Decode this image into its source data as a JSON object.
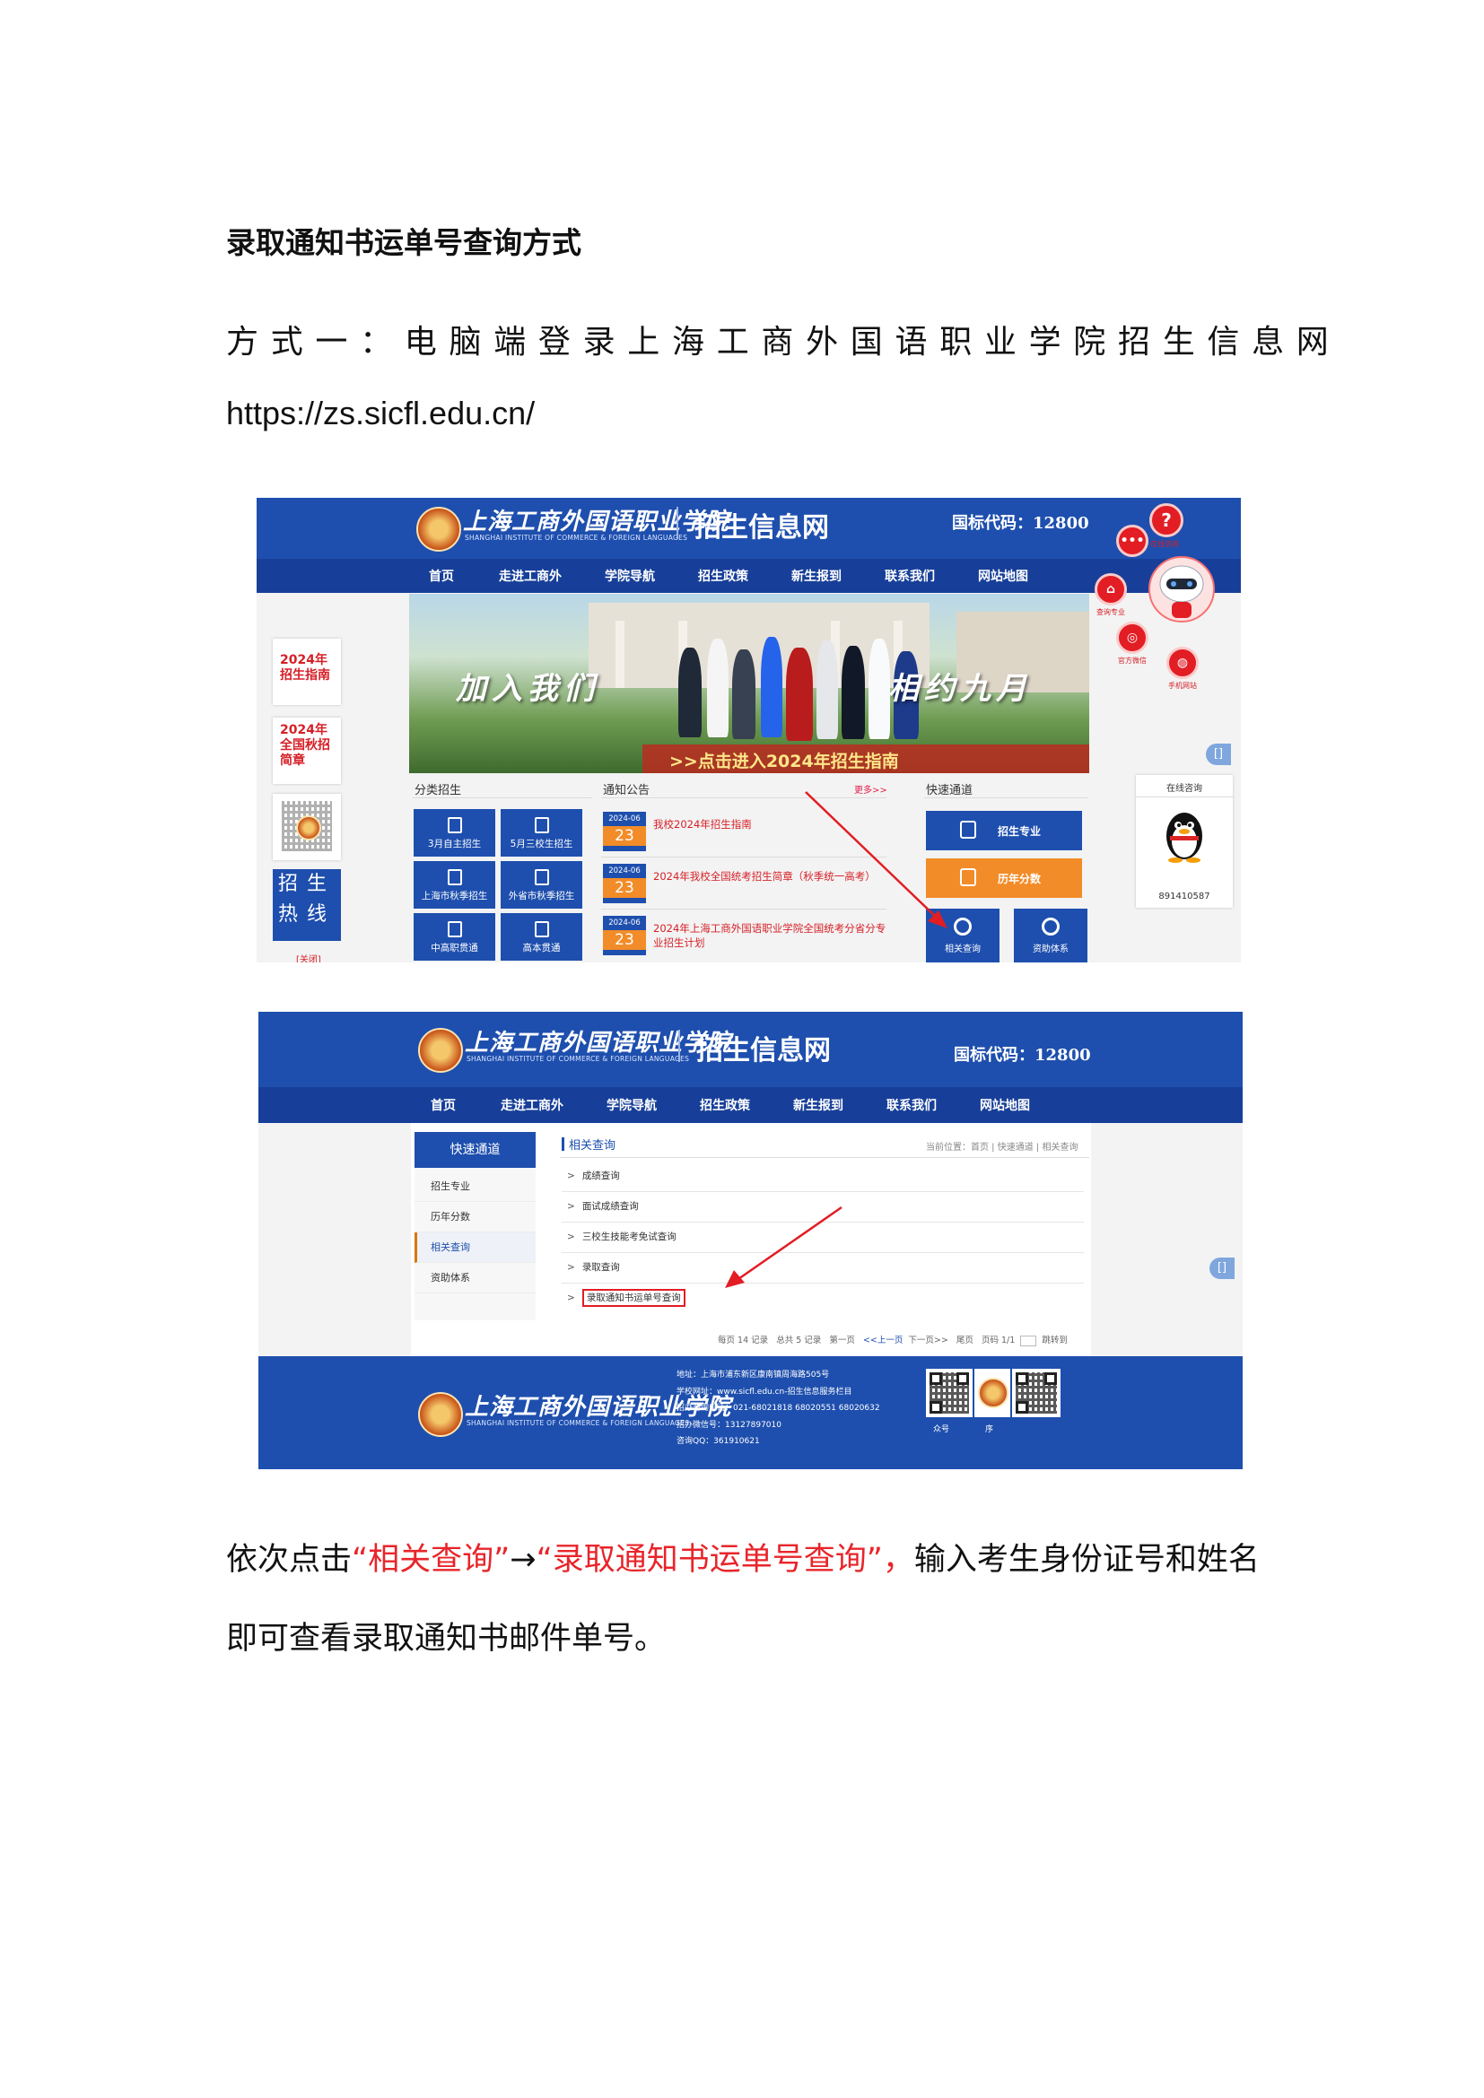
{
  "document": {
    "heading": "录取通知书运单号查询方式",
    "method_one": "方式一：电脑端登录上海工商外国语职业学院招生信息网",
    "url": "https://zs.sicfl.edu.cn/",
    "instruction": {
      "line1_prefix": "依次点击",
      "highlight1": "“相关查询”",
      "arrow": "→",
      "highlight2": "“录取通知书运单号查询”，",
      "line1_suffix": "输入考生身份证号和姓名",
      "line2": "即可查看录取通知书邮件单号。"
    }
  },
  "site": {
    "logo_text": "上海工商外国语职业学院",
    "logo_sub": "SHANGHAI INSTITUTE OF COMMERCE & FOREIGN LANGUAGES",
    "name": "招生信息网",
    "intl_code": "国标代码：12800",
    "nav": [
      "首页",
      "走进工商外",
      "学院导航",
      "招生政策",
      "新生报到",
      "联系我们",
      "网站地图"
    ]
  },
  "home": {
    "banner_left": "加入我们",
    "banner_right": "相约九月",
    "banner_bar": ">>点击进入2024年招生指南",
    "side_cards": [
      "2024年招生指南",
      "2024年全国秋招简章"
    ],
    "hotline": "招生热线",
    "close": "[关闭]",
    "sections": {
      "category": "分类招生",
      "notice": "通知公告",
      "more": "更多>>",
      "quick": "快速通道"
    },
    "tiles": [
      "3月自主招生",
      "5月三校生招生",
      "上海市秋季招生",
      "外省市秋季招生",
      "中高职贯通",
      "高本贯通"
    ],
    "news": [
      {
        "ym": "2024-06",
        "d": "23",
        "title": "我校2024年招生指南"
      },
      {
        "ym": "2024-06",
        "d": "23",
        "title": "2024年我校全国统考招生简章（秋季统一高考）"
      },
      {
        "ym": "2024-06",
        "d": "23",
        "title": "2024年上海工商外国语职业学院全国统考分省分专业招生计划"
      }
    ],
    "quick_buttons": [
      "招生专业",
      "历年分数"
    ],
    "quick_squares": [
      "相关查询",
      "资助体系"
    ],
    "float_top": [
      "",
      "在线咨询"
    ],
    "float_mid": [
      "查询专业",
      "官方微信",
      "手机网站"
    ],
    "online_title": "在线咨询",
    "qq_number": "891410587",
    "edge_tab": "[]"
  },
  "query_page": {
    "sidebar_title": "快速通道",
    "sidebar_items": [
      "招生专业",
      "历年分数",
      "相关查询",
      "资助体系"
    ],
    "section_title": "相关查询",
    "breadcrumb": "当前位置：首页 | 快速通道 | 相关查询",
    "list": [
      "成绩查询",
      "面试成绩查询",
      "三校生技能考免试查询",
      "录取查询",
      "录取通知书运单号查询"
    ],
    "pager": {
      "per_page": "每页 14 记录",
      "total": "总共 5 记录",
      "first": "第一页",
      "prev": "<<上一页",
      "next": "下一页>>",
      "last": "尾页",
      "page": "页码 1/1",
      "jump": "跳转到"
    },
    "footer": {
      "address": "地址：上海市浦东新区康南镇周海路505号",
      "website": "学校网址：www.sicfl.edu.cn-招生信息服务栏目",
      "phone": "招办咨询电话：021-68021818 68020551 68020632",
      "wechat": "招办微信号：13127897010",
      "qq": "咨询QQ：361910621",
      "qr_labels": [
        "众号",
        "序"
      ]
    }
  }
}
